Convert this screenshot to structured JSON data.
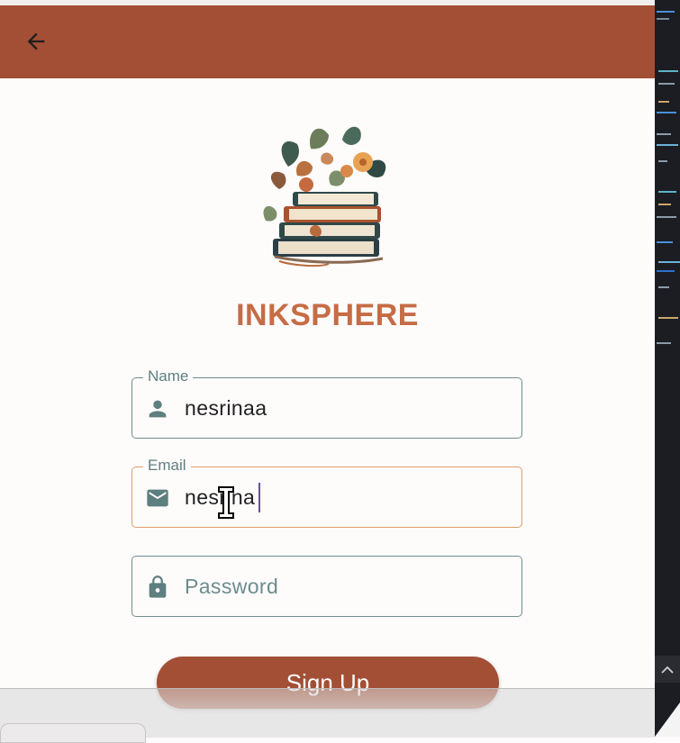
{
  "app": {
    "brand_name": "INKSPHERE",
    "colors": {
      "primary": "#a34f35",
      "brand_text": "#c66c45",
      "outline": "#6f8f8e",
      "focus_outline": "#d9a06b"
    }
  },
  "appbar": {
    "back_icon": "arrow-left-icon"
  },
  "form": {
    "name": {
      "label": "Name",
      "value": "nesrinaa",
      "icon": "person-icon"
    },
    "email": {
      "label": "Email",
      "value": "nesrina",
      "icon": "mail-icon"
    },
    "password": {
      "placeholder": "Password",
      "icon": "lock-icon"
    },
    "submit_label": "Sign Up"
  }
}
